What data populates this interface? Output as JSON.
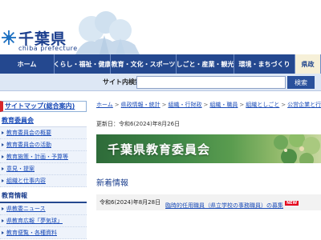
{
  "header": {
    "title": "千葉県",
    "subtitle": "chiba prefecture"
  },
  "nav": {
    "items": [
      {
        "label": "ホーム"
      },
      {
        "label": "くらし・福祉・健康"
      },
      {
        "label": "教育・文化・スポーツ"
      },
      {
        "label": "しごと・産業・観光"
      },
      {
        "label": "環境・まちづくり"
      },
      {
        "label": "県政"
      }
    ]
  },
  "search": {
    "label": "サイト内検索",
    "value": "",
    "button": "検索"
  },
  "sidebar": {
    "sitemap": "サイトマップ(総合案内)",
    "sections": [
      {
        "title": "教育委員会",
        "items": [
          "教育委員会の概要",
          "教育委員会の活動",
          "教育施策・計画・予算等",
          "意見・提案",
          "組織と仕事内容"
        ]
      },
      {
        "title": "教育情報",
        "items": [
          "県教委ニュース",
          "県教育広報「夢気球」",
          "教育便覧・各種資料"
        ]
      }
    ]
  },
  "breadcrumb": [
    "ホーム",
    "県政情報・統計",
    "組織・行財政",
    "組織・職員",
    "組織としごと",
    "公営企業と行政委員会事務局"
  ],
  "main": {
    "updated": "更新日：令和6(2024)年8月26日",
    "banner_title": "千葉県教育委員会",
    "news_heading": "新着情報",
    "news": [
      {
        "date": "令和6(2024)年8月28日",
        "title": "臨時的任用職員（県立学校の事務職員）の募集",
        "badge": "NEW"
      }
    ]
  },
  "colors": {
    "nav_bg": "#24488f",
    "brand_blue": "#1c3f8e",
    "link": "#1b4cb8",
    "accent_red": "#d7262b",
    "banner_green": "#3f8647"
  }
}
